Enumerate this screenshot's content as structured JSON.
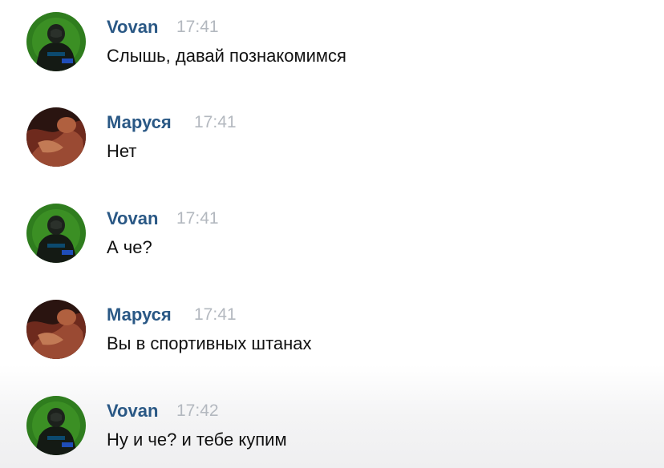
{
  "messages": [
    {
      "author": "Vovan",
      "time": "17:41",
      "text": "Слышь, давай познакомимся",
      "avatar": "vovan-avatar"
    },
    {
      "author": "Маруся",
      "time": "17:41",
      "text": "Нет",
      "avatar": "marusya-avatar"
    },
    {
      "author": "Vovan",
      "time": "17:41",
      "text": "А че?",
      "avatar": "vovan-avatar"
    },
    {
      "author": "Маруся",
      "time": "17:41",
      "text": "Вы в спортивных штанах",
      "avatar": "marusya-avatar"
    },
    {
      "author": "Vovan",
      "time": "17:42",
      "text": "Ну и че? и тебе купим",
      "avatar": "vovan-avatar"
    }
  ],
  "colors": {
    "author": "#2a5885",
    "time": "#b3b8bf",
    "text": "#111111"
  }
}
